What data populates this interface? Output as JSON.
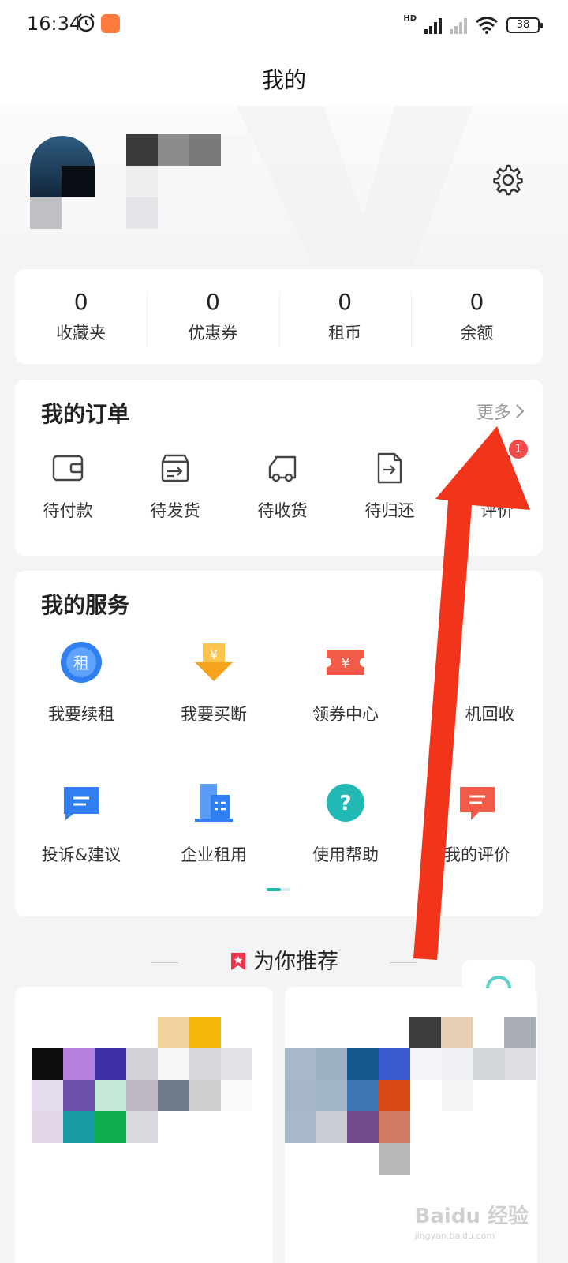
{
  "status_bar": {
    "time": "16:34",
    "battery": "38",
    "network": "HD"
  },
  "header": {
    "title": "我的"
  },
  "stats": [
    {
      "value": "0",
      "label": "收藏夹"
    },
    {
      "value": "0",
      "label": "优惠券"
    },
    {
      "value": "0",
      "label": "租币"
    },
    {
      "value": "0",
      "label": "余额"
    }
  ],
  "orders": {
    "title": "我的订单",
    "more": "更多",
    "items": [
      {
        "label": "待付款",
        "icon": "wallet-icon"
      },
      {
        "label": "待发货",
        "icon": "box-icon"
      },
      {
        "label": "待收货",
        "icon": "truck-icon"
      },
      {
        "label": "待归还",
        "icon": "return-doc-icon"
      },
      {
        "label": "评价",
        "icon": "review-icon",
        "badge": "1"
      }
    ]
  },
  "services": {
    "title": "我的服务",
    "items": [
      {
        "label": "我要续租",
        "icon": "renew-icon",
        "color": "#2f7ff0"
      },
      {
        "label": "我要买断",
        "icon": "buyout-icon",
        "color": "#f6a21c"
      },
      {
        "label": "领券中心",
        "icon": "coupon-icon",
        "color": "#f25b47"
      },
      {
        "label": "机回收",
        "icon": "recycle-icon",
        "color": "#2bb5b0"
      },
      {
        "label": "投诉&建议",
        "icon": "feedback-icon",
        "color": "#2f7ff0"
      },
      {
        "label": "企业租用",
        "icon": "enterprise-icon",
        "color": "#2f7ff0"
      },
      {
        "label": "使用帮助",
        "icon": "help-icon",
        "color": "#22b8b4"
      },
      {
        "label": "我的评价",
        "icon": "my-review-icon",
        "color": "#f25b47"
      }
    ]
  },
  "recommend": {
    "title": "为你推荐"
  },
  "watermark": {
    "brand": "Baidu 经验",
    "url": "jingyan.baidu.com"
  },
  "colors": {
    "accent": "#22b8b4",
    "arrow": "#f2341a",
    "badge": "#f04a4a"
  }
}
